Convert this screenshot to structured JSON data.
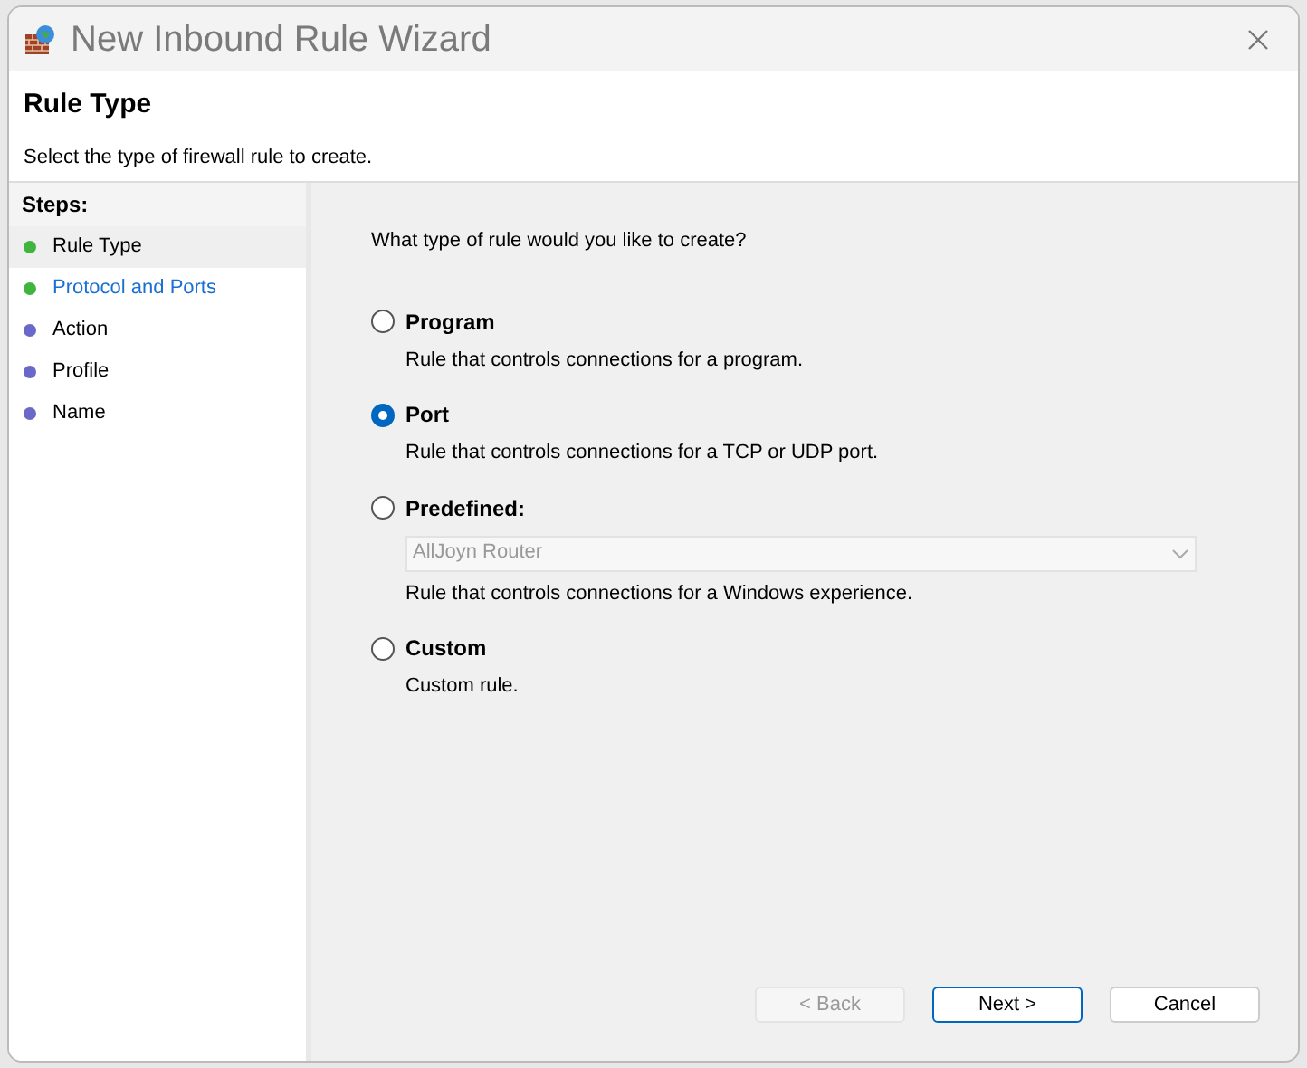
{
  "window": {
    "title": "New Inbound Rule Wizard"
  },
  "header": {
    "title": "Rule Type",
    "subtitle": "Select the type of firewall rule to create."
  },
  "steps": {
    "heading": "Steps:",
    "items": [
      {
        "label": "Rule Type",
        "selected": true,
        "link": false,
        "color": "#3fb53f"
      },
      {
        "label": "Protocol and Ports",
        "selected": false,
        "link": true,
        "color": "#3fb53f"
      },
      {
        "label": "Action",
        "selected": false,
        "link": false,
        "color": "#6a68c8"
      },
      {
        "label": "Profile",
        "selected": false,
        "link": false,
        "color": "#6a68c8"
      },
      {
        "label": "Name",
        "selected": false,
        "link": false,
        "color": "#6a68c8"
      }
    ]
  },
  "question": "What type of rule would you like to create?",
  "options": [
    {
      "label": "Program",
      "selected": false,
      "description": "Rule that controls connections for a program."
    },
    {
      "label": "Port",
      "selected": true,
      "description": "Rule that controls connections for a TCP or UDP port."
    },
    {
      "label": "Predefined:",
      "selected": false,
      "dropdown": {
        "value": "AllJoyn Router",
        "disabled": true
      },
      "description": "Rule that controls connections for a Windows experience."
    },
    {
      "label": "Custom",
      "selected": false,
      "description": "Custom rule."
    }
  ],
  "buttons": [
    {
      "label": "< Back",
      "disabled": true,
      "default": false
    },
    {
      "label": "Next >",
      "disabled": false,
      "default": true
    },
    {
      "label": "Cancel",
      "disabled": false,
      "default": false
    }
  ]
}
